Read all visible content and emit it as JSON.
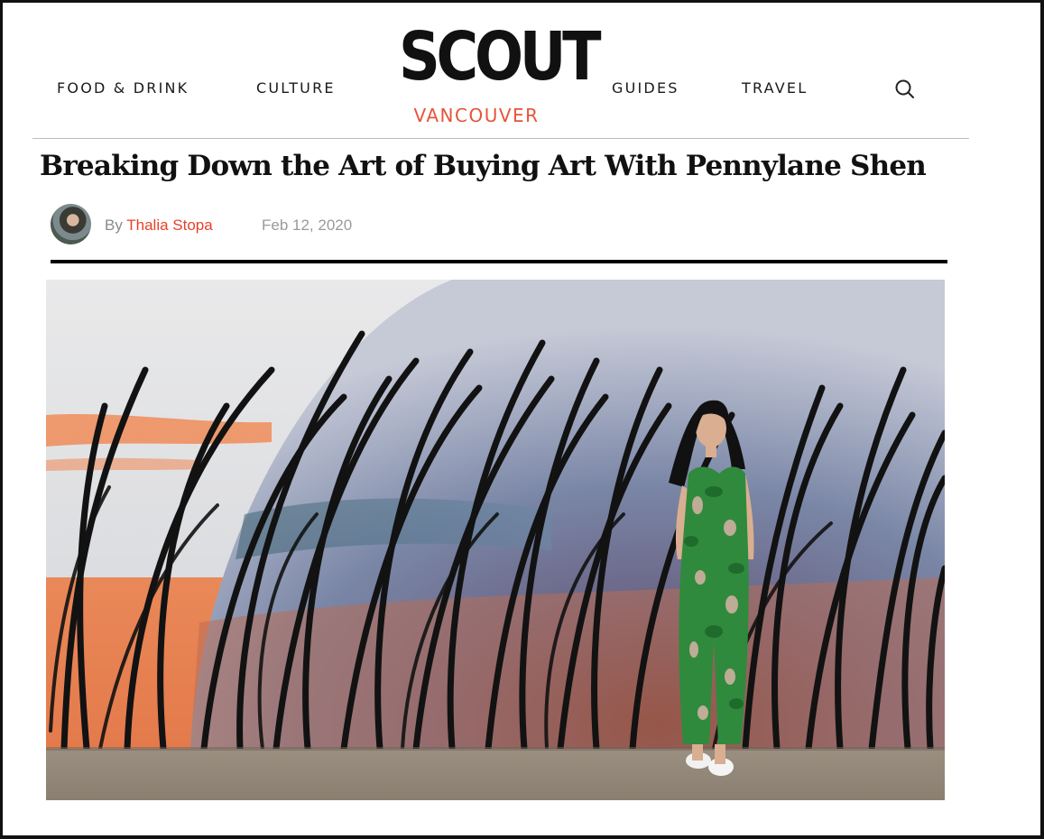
{
  "nav": {
    "left": [
      {
        "label": "FOOD & DRINK"
      },
      {
        "label": "CULTURE"
      }
    ],
    "right": [
      {
        "label": "GUIDES"
      },
      {
        "label": "TRAVEL"
      }
    ],
    "search_icon": "search-icon"
  },
  "logo": {
    "word": "SCOUT",
    "city": "VANCOUVER",
    "city_color": "#e8543a"
  },
  "article": {
    "title": "Breaking Down the Art of Buying Art With Pennylane Shen",
    "by_prefix": "By",
    "author": "Thalia Stopa",
    "date": "Feb 12, 2020",
    "author_color": "#e8402a"
  },
  "hero": {
    "icon": "photo-image"
  }
}
